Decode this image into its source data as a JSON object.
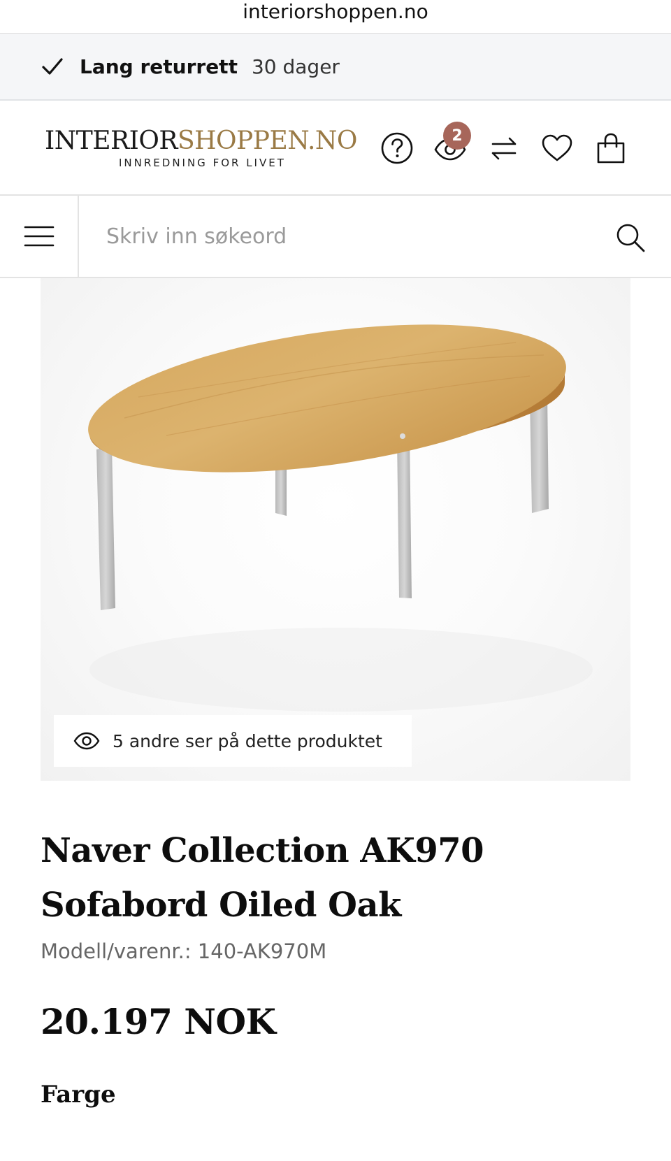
{
  "browser": {
    "url": "interiorshoppen.no"
  },
  "banner": {
    "strong": "Lang returrett",
    "light": "30 dager",
    "icon": "check-icon"
  },
  "header": {
    "logo_part1": "INTERIOR",
    "logo_part2": "SHOPPEN.NO",
    "logo_tagline": "INNREDNING FOR LIVET",
    "recently_viewed_count": "2",
    "icons": [
      "help-icon",
      "recently-viewed-icon",
      "compare-icon",
      "wishlist-heart-icon",
      "shopping-bag-icon"
    ]
  },
  "search": {
    "placeholder": "Skriv inn søkeord",
    "value": ""
  },
  "product": {
    "viewers_text": "5 andre ser på dette produktet",
    "title": "Naver Collection AK970 Sofabord Oiled Oak",
    "model": "Modell/varenr.: 140-AK970M",
    "price": "20.197 NOK",
    "color_label": "Farge"
  },
  "colors": {
    "brand_gold": "#9a7a45",
    "badge": "#a7665a",
    "banner_bg": "#f5f6f8"
  }
}
